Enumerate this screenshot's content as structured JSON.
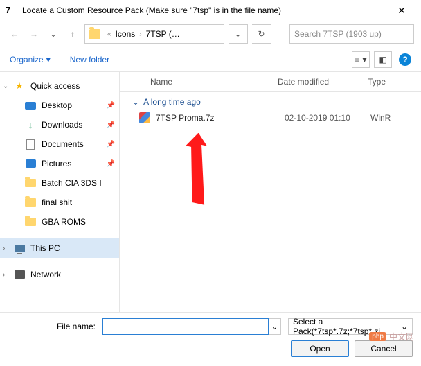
{
  "titlebar": {
    "app_icon_text": "7",
    "title": "Locate a Custom Resource Pack (Make sure \"7tsp\" is in the file name)",
    "close": "✕"
  },
  "nav": {
    "back": "←",
    "forward": "→",
    "dropdown": "⌄",
    "up": "↑",
    "refresh": "↻"
  },
  "breadcrumb": {
    "sep1": "«",
    "crumb1": "Icons",
    "sep2": "›",
    "crumb2": "7TSP (…",
    "drop": "⌄"
  },
  "search": {
    "placeholder": "Search 7TSP (1903 up)"
  },
  "toolbar": {
    "organize": "Organize",
    "organize_caret": "▾",
    "newfolder": "New folder",
    "view_caret": "▾",
    "help": "?"
  },
  "sidebar": {
    "quick_chev": "⌄",
    "quick": "Quick access",
    "items": [
      {
        "label": "Desktop"
      },
      {
        "label": "Downloads"
      },
      {
        "label": "Documents"
      },
      {
        "label": "Pictures"
      },
      {
        "label": "Batch CIA 3DS I"
      },
      {
        "label": "final shit"
      },
      {
        "label": "GBA ROMS"
      }
    ],
    "pin": "📌",
    "thispc_chev": "›",
    "thispc": "This PC",
    "network_chev": "›",
    "network": "Network"
  },
  "filepane": {
    "headers": {
      "name": "Name",
      "date": "Date modified",
      "type": "Type"
    },
    "group_chev": "⌄",
    "group": "A long time ago",
    "files": [
      {
        "name": "7TSP Proma.7z",
        "date": "02-10-2019 01:10",
        "type": "WinR"
      }
    ]
  },
  "bottom": {
    "filename_label": "File name:",
    "filename_value": "",
    "filter": "Select a Pack(*7tsp*.7z;*7tsp*.zi",
    "filter_caret": "⌄",
    "filename_caret": "⌄",
    "open": "Open",
    "cancel": "Cancel"
  },
  "watermark": {
    "badge": "php",
    "text": "中文网"
  }
}
